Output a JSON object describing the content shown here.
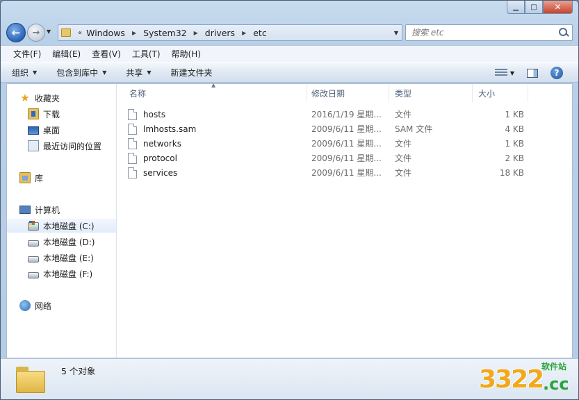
{
  "window": {
    "caption_min": "▁",
    "caption_max": "□",
    "caption_close": "✕"
  },
  "nav": {
    "overflow": "«",
    "breadcrumbs": [
      "Windows",
      "System32",
      "drivers",
      "etc"
    ],
    "search_placeholder": "搜索 etc"
  },
  "menubar": [
    "文件(F)",
    "编辑(E)",
    "查看(V)",
    "工具(T)",
    "帮助(H)"
  ],
  "commandbar": {
    "organize": "组织",
    "include_library": "包含到库中",
    "share": "共享",
    "new_folder": "新建文件夹",
    "help": "?"
  },
  "sidebar": {
    "favorites": "收藏夹",
    "downloads": "下载",
    "desktop": "桌面",
    "recent": "最近访问的位置",
    "libraries": "库",
    "computer": "计算机",
    "drive_c": "本地磁盘 (C:)",
    "drive_d": "本地磁盘 (D:)",
    "drive_e": "本地磁盘 (E:)",
    "drive_f": "本地磁盘 (F:)",
    "network": "网络"
  },
  "columns": {
    "name": "名称",
    "date": "修改日期",
    "type": "类型",
    "size": "大小"
  },
  "files": [
    {
      "name": "hosts",
      "date": "2016/1/19 星期...",
      "type": "文件",
      "size": "1 KB"
    },
    {
      "name": "lmhosts.sam",
      "date": "2009/6/11 星期...",
      "type": "SAM 文件",
      "size": "4 KB"
    },
    {
      "name": "networks",
      "date": "2009/6/11 星期...",
      "type": "文件",
      "size": "1 KB"
    },
    {
      "name": "protocol",
      "date": "2009/6/11 星期...",
      "type": "文件",
      "size": "2 KB"
    },
    {
      "name": "services",
      "date": "2009/6/11 星期...",
      "type": "文件",
      "size": "18 KB"
    }
  ],
  "details": {
    "item_count": "5 个对象"
  },
  "watermark": {
    "number": "3322",
    "suffix": ".cc",
    "tagline": "软件站"
  }
}
